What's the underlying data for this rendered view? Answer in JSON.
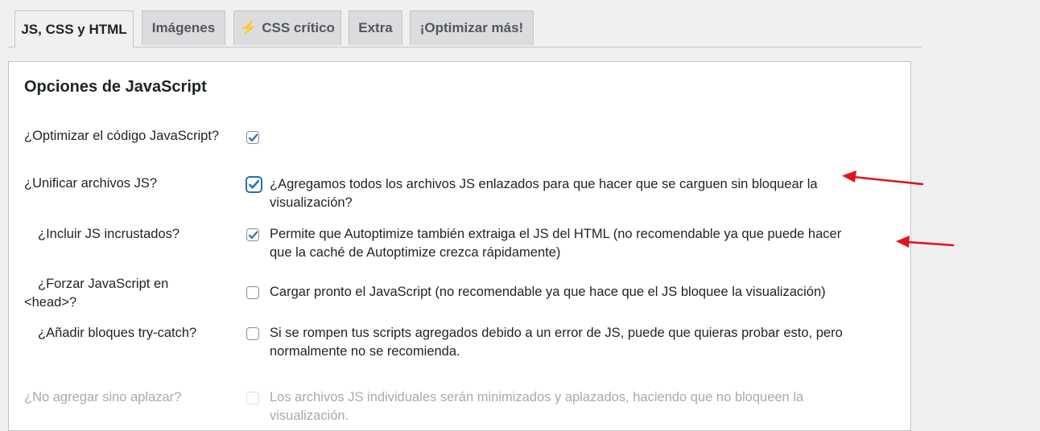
{
  "tabs": [
    {
      "label": "JS, CSS y HTML",
      "active": true
    },
    {
      "label": "Imágenes",
      "active": false
    },
    {
      "label": "CSS crítico",
      "active": false,
      "icon": "lightning-icon"
    },
    {
      "label": "Extra",
      "active": false
    },
    {
      "label": "¡Optimizar más!",
      "active": false
    }
  ],
  "section": {
    "title": "Opciones de JavaScript"
  },
  "options": {
    "optimize": {
      "label": "¿Optimizar el código JavaScript?",
      "checked": true,
      "desc": ""
    },
    "aggregate": {
      "label": "¿Unificar archivos JS?",
      "checked": true,
      "desc_line1": "¿Agregamos todos los archivos JS enlazados para que hacer que se carguen sin bloquear la",
      "desc_line2": "visualización?"
    },
    "inline": {
      "label": "¿Incluir JS incrustados?",
      "checked": true,
      "desc_line1": "Permite que Autoptimize también extraiga el JS del HTML (no recomendable ya que puede hacer",
      "desc_line2": "que la caché de Autoptimize crezca rápidamente)"
    },
    "forcehead": {
      "label_line1": "¿Forzar JavaScript en",
      "label_line2": "<head>?",
      "checked": false,
      "desc": "Cargar pronto el JavaScript (no recomendable ya que hace que el JS bloquee la visualización)"
    },
    "trycatch": {
      "label": "¿Añadir bloques try-catch?",
      "checked": false,
      "desc_line1": "Si se rompen tus scripts agregados debido a un error de JS, puede que quieras probar esto, pero",
      "desc_line2": "normalmente no se recomienda."
    },
    "defer": {
      "label": "¿No agregar sino aplazar?",
      "checked": false,
      "disabled": true,
      "desc_line1": "Los archivos JS individuales serán minimizados y aplazados, haciendo que no bloqueen la",
      "desc_line2": "visualización."
    }
  },
  "colors": {
    "accent": "#2271b1",
    "annotation_arrow": "#e0141e"
  }
}
